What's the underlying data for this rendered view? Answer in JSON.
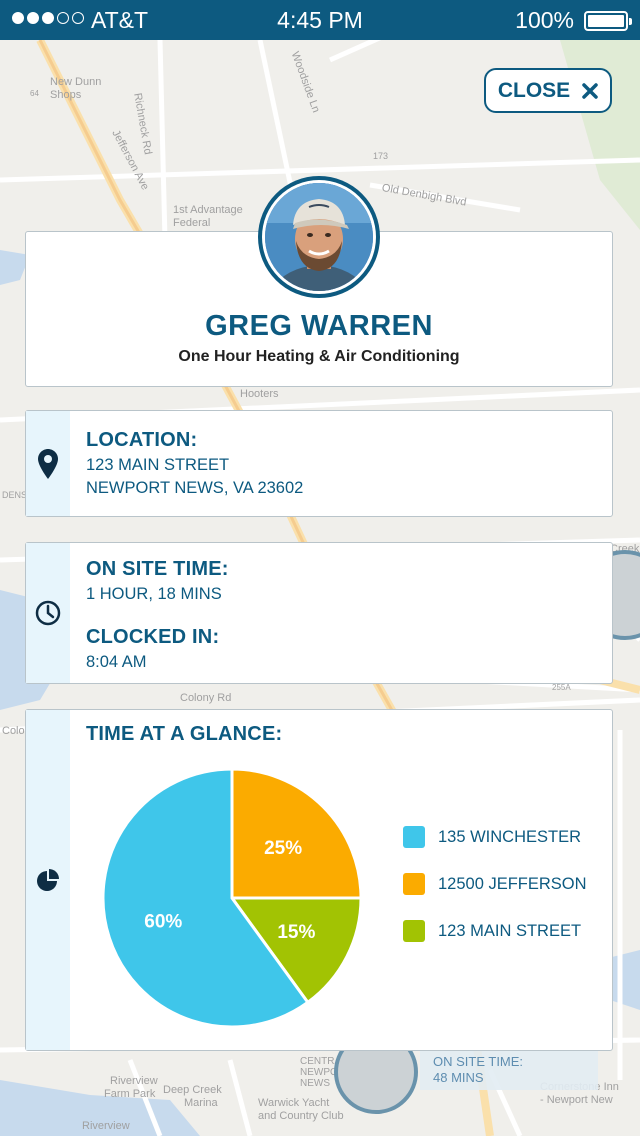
{
  "status_bar": {
    "carrier": "AT&T",
    "time": "4:45 PM",
    "battery": "100%",
    "signal_dots_filled": 3,
    "signal_dots_total": 5
  },
  "close_button": {
    "label": "CLOSE",
    "icon": "close-icon"
  },
  "technician": {
    "name": "GREG WARREN",
    "company": "One Hour Heating & Air Conditioning",
    "avatar_icon": "avatar-photo"
  },
  "location": {
    "heading": "LOCATION:",
    "line1": "123 MAIN STREET",
    "line2": "NEWPORT NEWS, VA 23602",
    "icon": "map-pin-icon"
  },
  "on_site": {
    "heading": "ON SITE TIME:",
    "value": "1 HOUR, 18 MINS",
    "clocked_heading": "CLOCKED IN:",
    "clocked_value": "8:04 AM",
    "icon": "clock-icon"
  },
  "glance": {
    "heading": "TIME AT A GLANCE:",
    "icon": "pie-chart-icon"
  },
  "chart_data": {
    "type": "pie",
    "slices": [
      {
        "label": "135 WINCHESTER",
        "value": 60,
        "display": "60%",
        "color": "#3fc6ea"
      },
      {
        "label": "12500 JEFFERSON",
        "value": 25,
        "display": "25%",
        "color": "#fbab00"
      },
      {
        "label": "123 MAIN STREET",
        "value": 15,
        "display": "15%",
        "color": "#a2c303"
      }
    ],
    "legend_placement": "right"
  },
  "map": {
    "labels": {
      "new_dunn": "New Dunn",
      "shops": "Shops",
      "richneck": "Richneck Rd",
      "woodside": "Woodside Ln",
      "jefferson": "Jefferson Ave",
      "old_denbigh": "Old Denbigh Blvd",
      "first_advantage": "1st Advantage",
      "federal": "Federal",
      "hooters": "Hooters",
      "colony": "Colony Rd",
      "dens": "DENS",
      "colo": "Colo",
      "creek": "Creek",
      "centra": "CENTRA",
      "newpor": "NEWPOR",
      "news": "NEWS",
      "riverview_farm": "Riverview",
      "farm_park": "Farm Park",
      "deep_creek": "Deep Creek",
      "marina": "Marina",
      "warwick": "Warwick Yacht",
      "country_club": "and Country Club",
      "riverview2": "Riverview",
      "cornerstone": "Cornerstone Inn",
      "newport_news": "- Newport New",
      "route_173": "173",
      "route_64": "64",
      "route_255a": "255A"
    },
    "bottom_tag": {
      "heading": "ON SITE TIME:",
      "value": "48 MINS"
    }
  }
}
